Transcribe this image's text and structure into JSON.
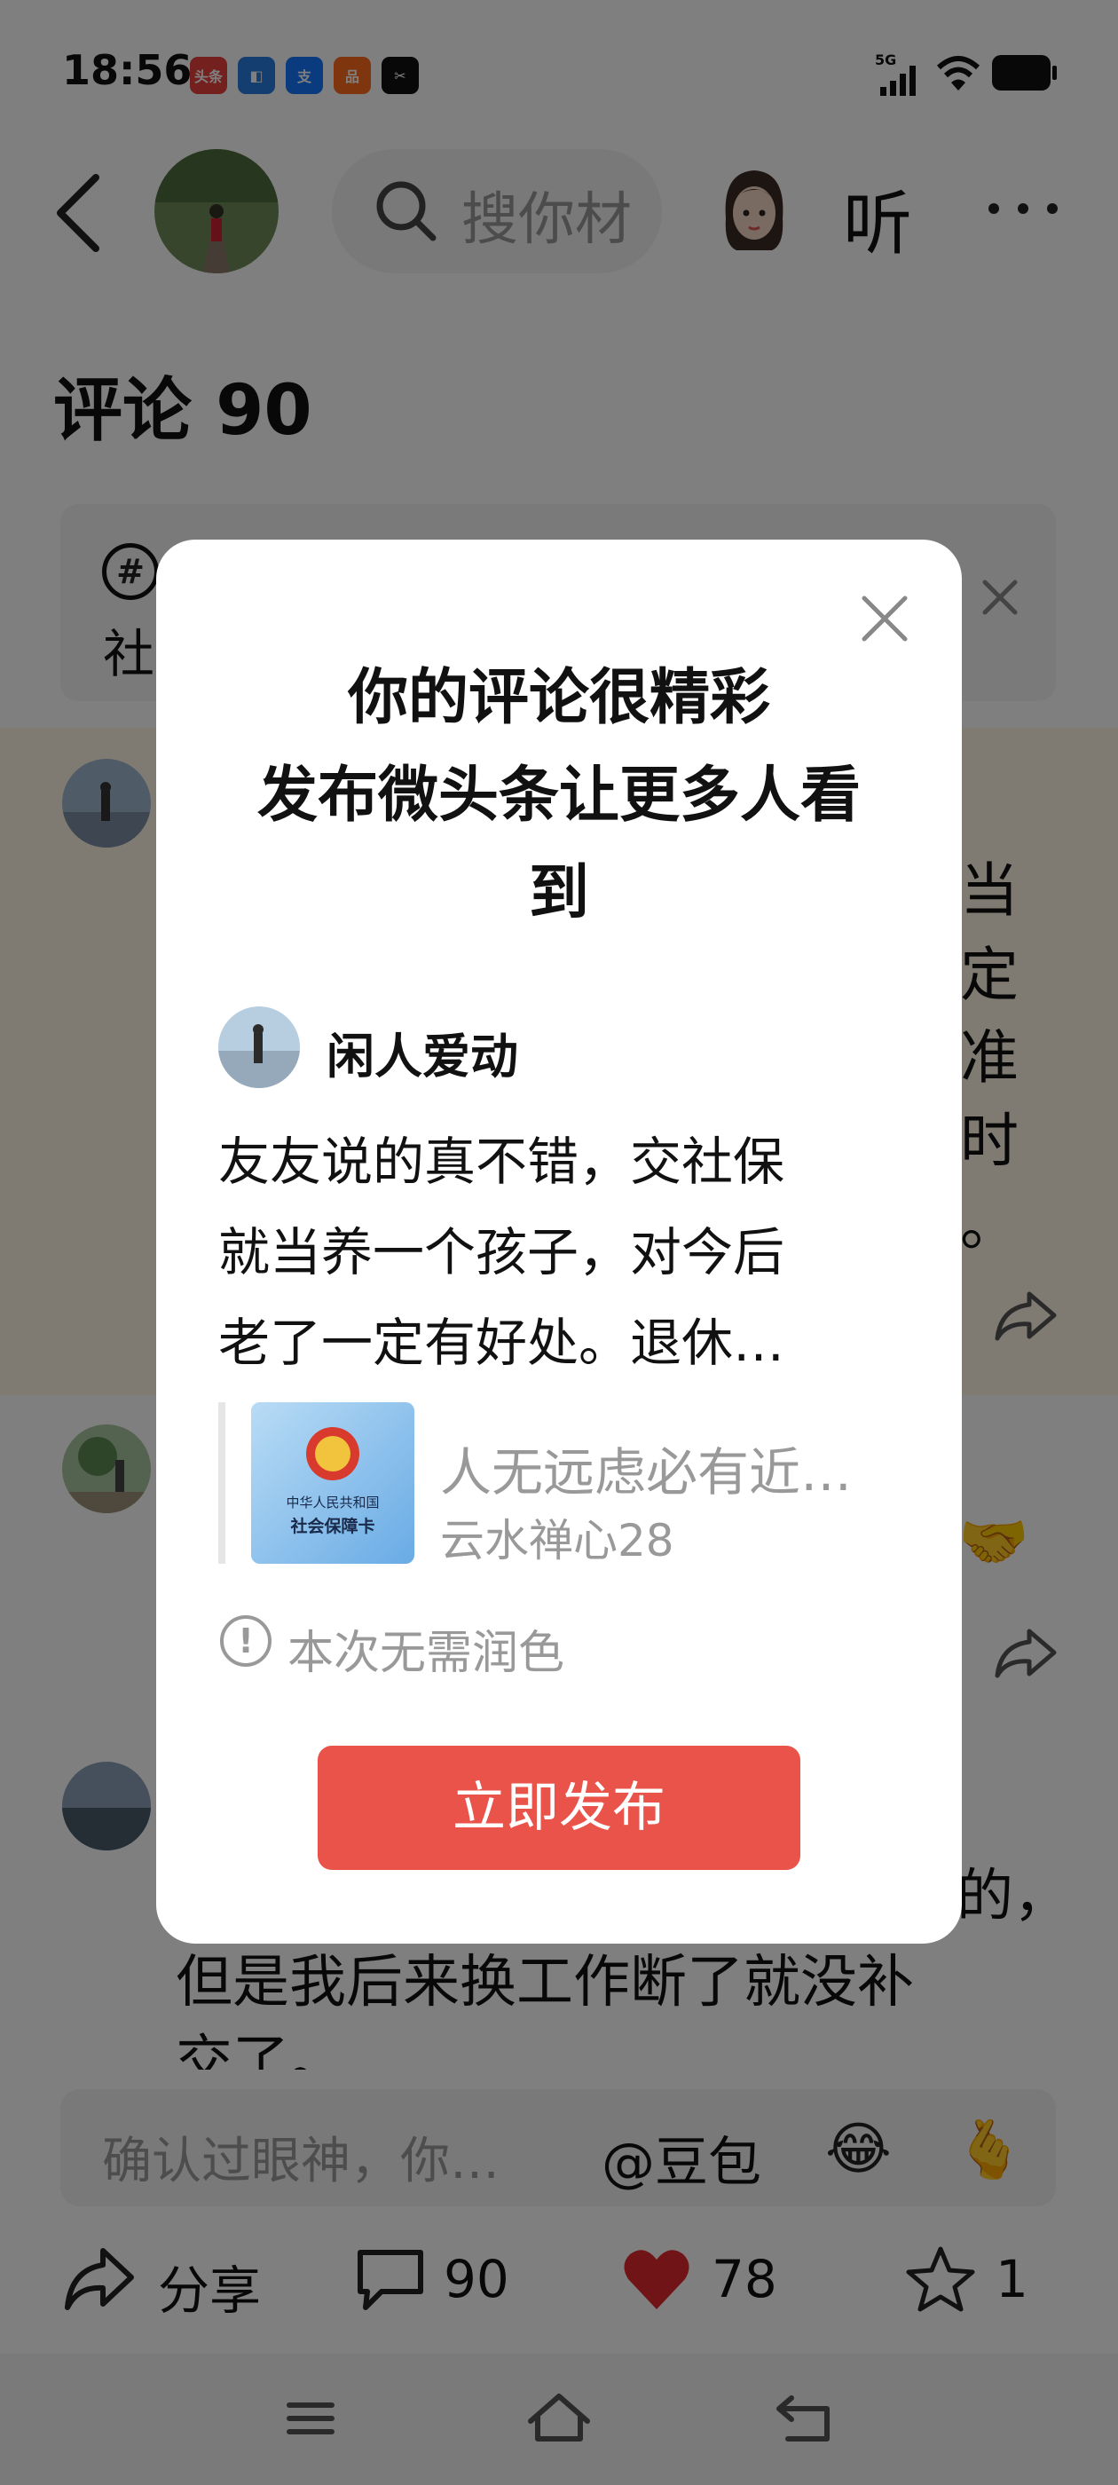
{
  "status_bar": {
    "time": "18:56",
    "app_icons": [
      {
        "name": "toutiao-icon",
        "text": "头条",
        "color": "#e8403c"
      },
      {
        "name": "app-blue-icon",
        "text": "◧",
        "color": "#2a7de1"
      },
      {
        "name": "alipay-icon",
        "text": "支",
        "color": "#1677ff"
      },
      {
        "name": "app-orange-icon",
        "text": "品",
        "color": "#ff6a1a"
      },
      {
        "name": "capcut-icon",
        "text": "✂",
        "color": "#111111"
      }
    ],
    "network": "5G"
  },
  "header": {
    "search_placeholder": "搜你材",
    "listen_label": "听"
  },
  "comments_title": "评论 90",
  "topic": {
    "icon": "#",
    "text": "社"
  },
  "comment1": {
    "line_tails": [
      "当",
      "定",
      "准",
      "时",
      "。"
    ]
  },
  "comment2": {
    "emoji": "🤝"
  },
  "comment3": {
    "line1_tail": "的，",
    "line2": "但是我后来换工作断了就没补",
    "line3": "交了。"
  },
  "input_bar": {
    "placeholder": "确认过眼神，你…",
    "mention": "@豆包",
    "emoji_laugh": "😂",
    "emoji_heart": "🫰"
  },
  "actions": {
    "share_label": "分享",
    "comment_count": "90",
    "like_count": "78",
    "favorite_count": "1"
  },
  "dialog": {
    "title_lines": [
      "你的评论很精彩",
      "发布微头条让更多人看",
      "到"
    ],
    "author_name": "闲人爱动",
    "body_lines": [
      "友友说的真不错，交社保",
      "就当养一个孩子，对今后",
      "老了一定有好处。退休…"
    ],
    "quote_title": "人无远虑必有近…",
    "quote_author": "云水禅心28",
    "quote_thumb_text": [
      "中华人民共和国",
      "社会保障卡"
    ],
    "polish_note": "本次无需润色",
    "publish_label": "立即发布"
  },
  "colors": {
    "publish_button": "#e9534a",
    "like_heart": "#e0282e",
    "highlight_row": "#fff6e4",
    "overlay": "rgba(0,0,0,0.5)"
  }
}
